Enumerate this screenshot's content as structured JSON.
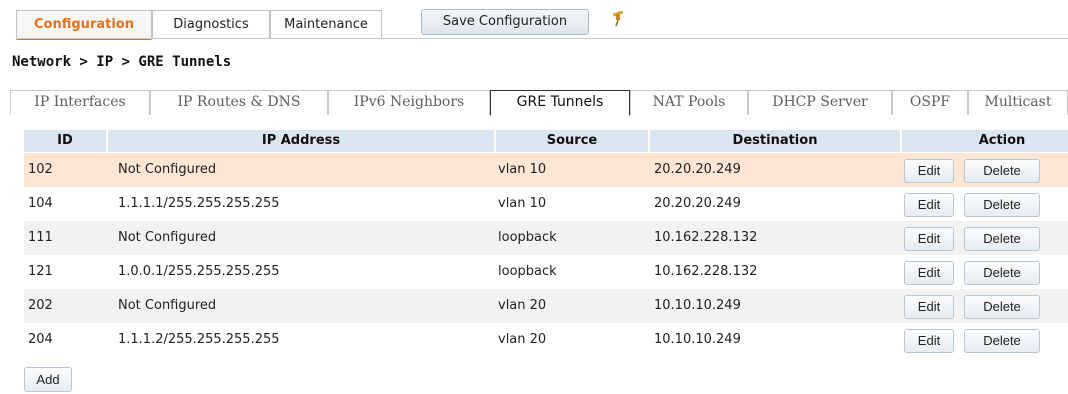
{
  "top_tabs": [
    {
      "label": "Configuration",
      "active": true
    },
    {
      "label": "Diagnostics",
      "active": false
    },
    {
      "label": "Maintenance",
      "active": false
    }
  ],
  "save_button": "Save Configuration",
  "pin_icon": "pin-icon",
  "breadcrumb": "Network > IP > GRE Tunnels",
  "sub_tabs": [
    {
      "label": "IP Interfaces",
      "active": false
    },
    {
      "label": "IP Routes & DNS",
      "active": false
    },
    {
      "label": "IPv6 Neighbors",
      "active": false
    },
    {
      "label": "GRE Tunnels",
      "active": true
    },
    {
      "label": "NAT Pools",
      "active": false
    },
    {
      "label": "DHCP Server",
      "active": false
    },
    {
      "label": "OSPF",
      "active": false
    },
    {
      "label": "Multicast",
      "active": false
    }
  ],
  "table": {
    "headers": {
      "id": "ID",
      "ip": "IP Address",
      "source": "Source",
      "destination": "Destination",
      "action": "Action"
    },
    "rows": [
      {
        "id": "102",
        "ip": "Not Configured",
        "source": "vlan 10",
        "destination": "20.20.20.249",
        "edit": "Edit",
        "delete": "Delete"
      },
      {
        "id": "104",
        "ip": "1.1.1.1/255.255.255.255",
        "source": "vlan 10",
        "destination": "20.20.20.249",
        "edit": "Edit",
        "delete": "Delete"
      },
      {
        "id": "111",
        "ip": "Not Configured",
        "source": "loopback",
        "destination": "10.162.228.132",
        "edit": "Edit",
        "delete": "Delete"
      },
      {
        "id": "121",
        "ip": "1.0.0.1/255.255.255.255",
        "source": "loopback",
        "destination": "10.162.228.132",
        "edit": "Edit",
        "delete": "Delete"
      },
      {
        "id": "202",
        "ip": "Not Configured",
        "source": "vlan 20",
        "destination": "10.10.10.249",
        "edit": "Edit",
        "delete": "Delete"
      },
      {
        "id": "204",
        "ip": "1.1.1.2/255.255.255.255",
        "source": "vlan 20",
        "destination": "10.10.10.249",
        "edit": "Edit",
        "delete": "Delete"
      }
    ]
  },
  "add_button": "Add",
  "colors": {
    "accent": "#e8701a",
    "header_bg": "#dbe6f1",
    "selected_row_bg": "#fde6d3",
    "alt_row_bg": "#f2f2f2"
  }
}
